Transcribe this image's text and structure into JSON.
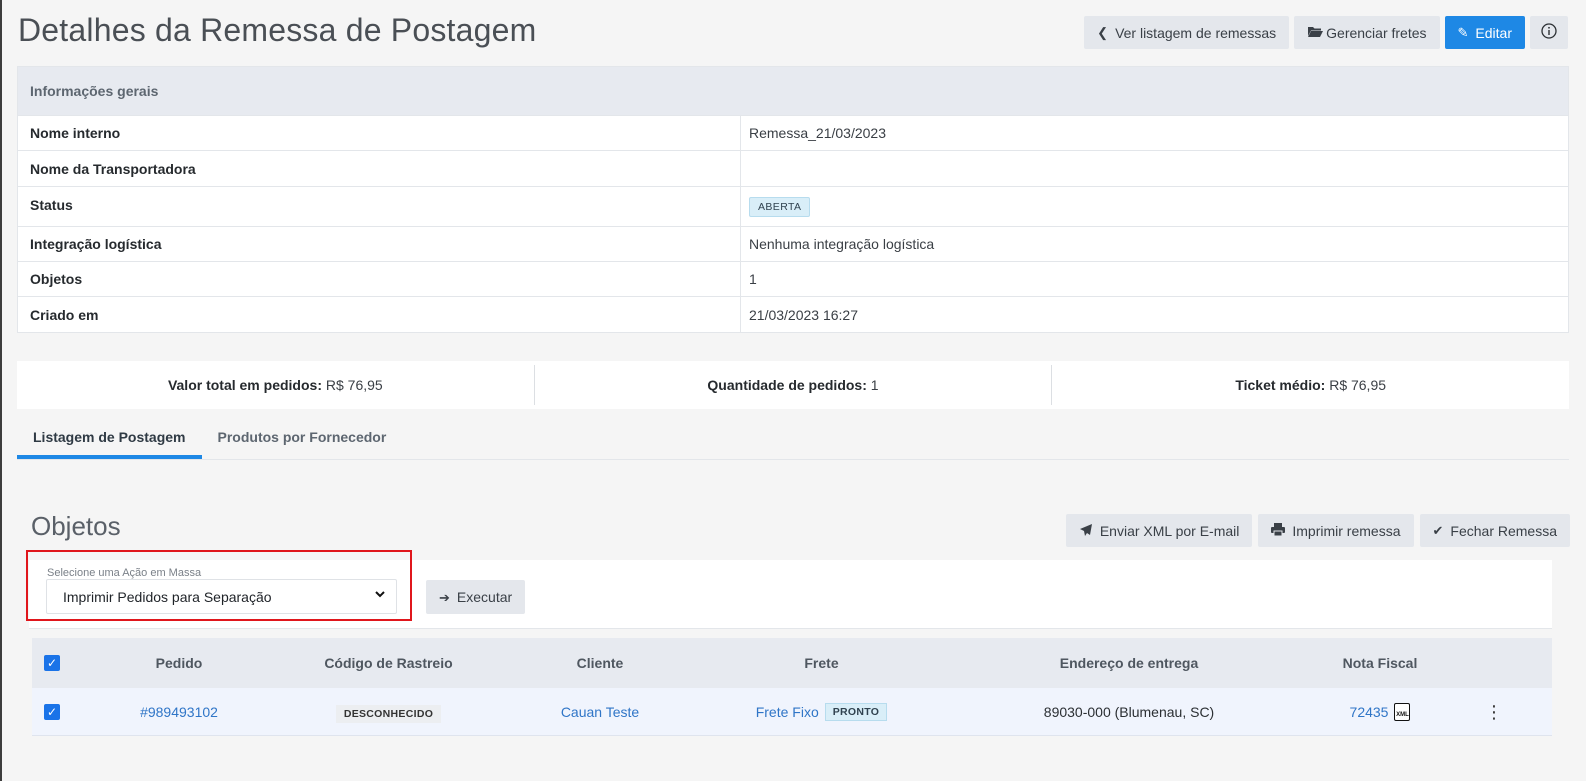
{
  "header": {
    "title": "Detalhes da Remessa de Postagem",
    "back_label": "Ver listagem de remessas",
    "fretes_label": "Gerenciar fretes",
    "edit_label": "Editar"
  },
  "info": {
    "section_title": "Informações gerais",
    "rows": [
      {
        "label": "Nome interno",
        "value": "Remessa_21/03/2023"
      },
      {
        "label": "Nome da Transportadora",
        "value": ""
      },
      {
        "label": "Status",
        "value": "ABERTA"
      },
      {
        "label": "Integração logística",
        "value": "Nenhuma integração logística"
      },
      {
        "label": "Objetos",
        "value": "1"
      },
      {
        "label": "Criado em",
        "value": "21/03/2023 16:27"
      }
    ]
  },
  "stats": [
    {
      "label": "Valor total em pedidos:",
      "value": "R$ 76,95"
    },
    {
      "label": "Quantidade de pedidos:",
      "value": "1"
    },
    {
      "label": "Ticket médio:",
      "value": "R$ 76,95"
    }
  ],
  "tabs": [
    {
      "label": "Listagem de Postagem",
      "active": true
    },
    {
      "label": "Produtos por Fornecedor",
      "active": false
    }
  ],
  "objects": {
    "title": "Objetos",
    "send_xml_label": "Enviar XML por E-mail",
    "print_label": "Imprimir remessa",
    "close_label": "Fechar Remessa",
    "bulk_label": "Selecione uma Ação em Massa",
    "bulk_selected": "Imprimir Pedidos para Separação",
    "execute_label": "Executar"
  },
  "orders": {
    "columns": [
      "Pedido",
      "Código de Rastreio",
      "Cliente",
      "Frete",
      "Endereço de entrega",
      "Nota Fiscal"
    ],
    "rows": [
      {
        "pedido": "#989493102",
        "rastreio": "DESCONHECIDO",
        "cliente": "Cauan Teste",
        "frete": "Frete Fixo",
        "frete_status": "PRONTO",
        "endereco": "89030-000 (Blumenau, SC)",
        "nota": "72435",
        "nota_icon": "XML"
      }
    ]
  },
  "colors": {
    "primary": "#1e88e5",
    "highlight_border": "#e0161c",
    "link": "#2f75c7"
  }
}
